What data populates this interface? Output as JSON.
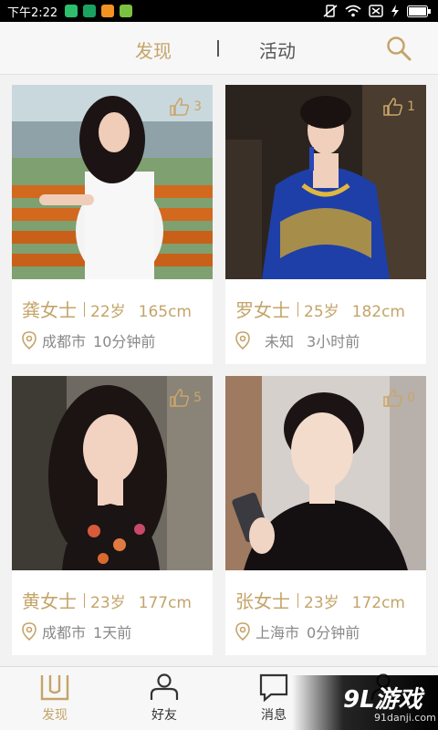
{
  "status_bar": {
    "time": "下午2:22",
    "app_icons": [
      {
        "name": "app-icon-green",
        "color": "#2dbf6b"
      },
      {
        "name": "app-icon-green2",
        "color": "#1aa260"
      },
      {
        "name": "app-icon-orange",
        "color": "#f29222"
      },
      {
        "name": "app-icon-android",
        "color": "#7cc242"
      }
    ]
  },
  "header": {
    "tab_discover": "发现",
    "tab_activity": "活动"
  },
  "colors": {
    "accent": "#c4a46a",
    "text": "#555555",
    "muted": "#888888"
  },
  "cards": [
    {
      "name": "龚女士",
      "age": "22岁",
      "height": "165cm",
      "city": "成都市",
      "when": "10分钟前",
      "likes": "3"
    },
    {
      "name": "罗女士",
      "age": "25岁",
      "height": "182cm",
      "city": "未知",
      "when": "3小时前",
      "likes": "1"
    },
    {
      "name": "黄女士",
      "age": "23岁",
      "height": "177cm",
      "city": "成都市",
      "when": "1天前",
      "likes": "5"
    },
    {
      "name": "张女士",
      "age": "23岁",
      "height": "172cm",
      "city": "上海市",
      "when": "0分钟前",
      "likes": "0"
    }
  ],
  "bottom_nav": {
    "discover": "发现",
    "friends": "好友",
    "messages": "消息"
  },
  "watermark": {
    "logo": "9L游戏",
    "url": "91danji.com"
  }
}
